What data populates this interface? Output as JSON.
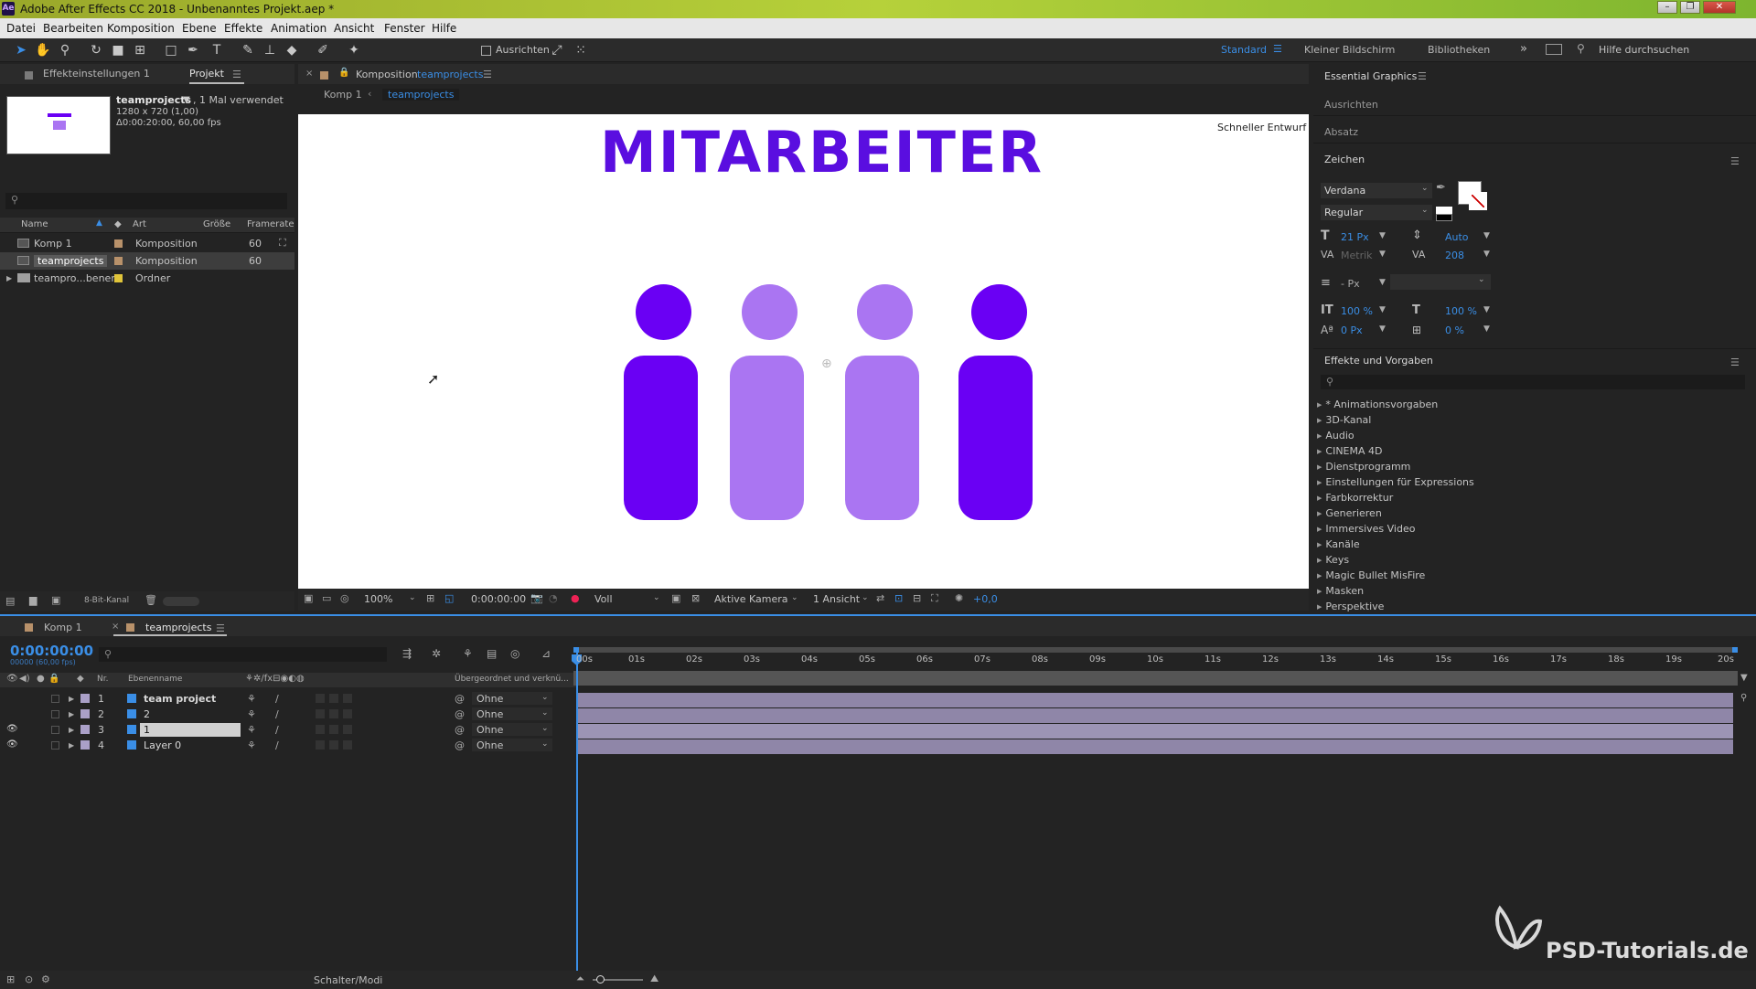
{
  "window": {
    "title": "Adobe After Effects CC 2018 - Unbenanntes Projekt.aep *",
    "logo_text": "Ae"
  },
  "menu": [
    "Datei",
    "Bearbeiten",
    "Komposition",
    "Ebene",
    "Effekte",
    "Animation",
    "Ansicht",
    "Fenster",
    "Hilfe"
  ],
  "toolbar": {
    "ausrichten_label": "Ausrichten",
    "workspaces": [
      "Standard",
      "Kleiner Bildschirm",
      "Bibliotheken"
    ],
    "search_placeholder": "Hilfe durchsuchen"
  },
  "project_panel": {
    "tabs": [
      "Effekteinstellungen 1",
      "Projekt"
    ],
    "selected_name": "teamprojects",
    "usage": ", 1 Mal verwendet",
    "size_info": "1280 x 720 (1,00)",
    "duration_info": "Δ0:00:20:00, 60,00 fps",
    "columns": [
      "Name",
      "Art",
      "Größe",
      "Framerate"
    ],
    "items": [
      {
        "name": "Komp 1",
        "type": "Komposition",
        "framerate": "60",
        "color": "#b8916a"
      },
      {
        "name": "teamprojects",
        "type": "Komposition",
        "framerate": "60",
        "color": "#b8916a"
      },
      {
        "name": "teampro...benen",
        "type": "Ordner",
        "framerate": "",
        "color": "#e0c43a"
      }
    ],
    "bit_depth": "8-Bit-Kanal"
  },
  "composition": {
    "tab_prefix": "Komposition",
    "tab_name": "teamprojects",
    "breadcrumb": [
      "Komp 1",
      "teamprojects"
    ],
    "draft_label": "Schneller Entwurf",
    "headline": "MITARBEITER",
    "colors": {
      "dark": "#6a00f4",
      "light": "#aa75f2",
      "headline": "#5a0ee0"
    },
    "footer": {
      "zoom": "100%",
      "timecode": "0:00:00:00",
      "resolution": "Voll",
      "camera": "Aktive Kamera",
      "views": "1 Ansicht",
      "exposure": "+0,0"
    }
  },
  "right_panel": {
    "essential_graphics": "Essential Graphics",
    "ausrichten": "Ausrichten",
    "absatz": "Absatz",
    "zeichen": "Zeichen",
    "font": "Verdana",
    "style": "Regular",
    "font_size": "21 Px",
    "leading": "Auto",
    "kerning": "Metrik",
    "tracking": "208",
    "stroke_width": "- Px",
    "vert_scale": "100 %",
    "horiz_scale": "100 %",
    "baseline": "0 Px",
    "tsume": "0 %",
    "effects_title": "Effekte und Vorgaben",
    "effects": [
      "* Animationsvorgaben",
      "3D-Kanal",
      "Audio",
      "CINEMA 4D",
      "Dienstprogramm",
      "Einstellungen für Expressions",
      "Farbkorrektur",
      "Generieren",
      "Immersives Video",
      "Kanäle",
      "Keys",
      "Magic Bullet MisFire",
      "Masken",
      "Perspektive"
    ]
  },
  "timeline": {
    "tabs": [
      "Komp 1",
      "teamprojects"
    ],
    "timecode": "0:00:00:00",
    "fps_info": "00000 (60,00 fps)",
    "columns": {
      "nr": "Nr.",
      "name": "Ebenenname",
      "parent": "Übergeordnet und verknü..."
    },
    "layers": [
      {
        "nr": "1",
        "name": "team project",
        "parent": "Ohne",
        "eye": false
      },
      {
        "nr": "2",
        "name": "2",
        "parent": "Ohne",
        "eye": false
      },
      {
        "nr": "3",
        "name": "1",
        "parent": "Ohne",
        "eye": true
      },
      {
        "nr": "4",
        "name": "Layer 0",
        "parent": "Ohne",
        "eye": true
      }
    ],
    "ruler": [
      "00s",
      "01s",
      "02s",
      "03s",
      "04s",
      "05s",
      "06s",
      "07s",
      "08s",
      "09s",
      "10s",
      "11s",
      "12s",
      "13s",
      "14s",
      "15s",
      "16s",
      "17s",
      "18s",
      "19s",
      "20s"
    ],
    "switches_label": "Schalter/Modi"
  },
  "watermark": "PSD-Tutorials.de"
}
